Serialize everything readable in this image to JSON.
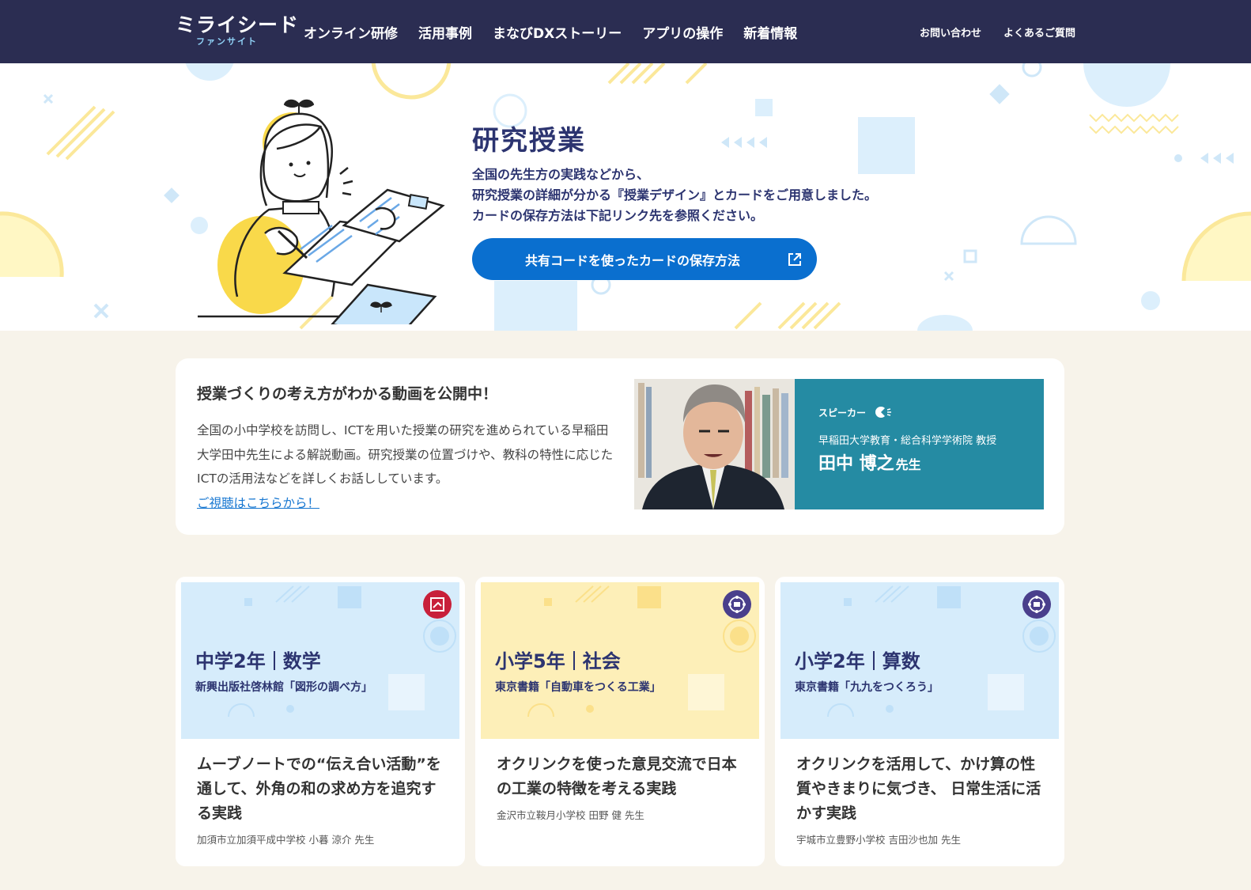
{
  "header": {
    "logo_main": "ミライシード",
    "logo_sub": "ファンサイト",
    "nav": [
      "オンライン研修",
      "活用事例",
      "まなびDXストーリー",
      "アプリの操作",
      "新着情報"
    ],
    "sub_nav": [
      "お問い合わせ",
      "よくあるご質問"
    ]
  },
  "hero": {
    "title": "研究授業",
    "description": [
      "全国の先生方の実践などから、",
      "研究授業の詳細が分かる『授業デザイン』とカードをご用意しました。",
      "カードの保存方法は下記リンク先を参照ください。"
    ],
    "button_label": "共有コードを使ったカードの保存方法"
  },
  "video": {
    "title": "授業づくりの考え方がわかる動画を公開中！",
    "body": "全国の小中学校を訪問し、ICTを用いた授業の研究を進められている早稲田大学田中先生による解説動画。研究授業の位置づけや、教科の特性に応じたICTの活用法などを詳しくお話ししています。",
    "link": "ご視聴はこちらから！",
    "speaker_label": "スピーカー",
    "speaker_affiliation": "早稲田大学教育・総合科学学術院 教授",
    "speaker_name": "田中 博之",
    "speaker_honorific": "先生"
  },
  "lessons": [
    {
      "grade": "中学2年",
      "subject": "数学",
      "textbook": "新興出版社啓林館「図形の調べ方」",
      "title": "ムーブノートでの“伝え合い活動”を通して、外角の和の求め方を追究する実践",
      "school": "加須市立加須平成中学校 小暮 涼介 先生",
      "thumb_color": "#d6ecfb",
      "badge_color": "#c8203a",
      "badge_icon": "movenote-icon"
    },
    {
      "grade": "小学5年",
      "subject": "社会",
      "textbook": "東京書籍「自動車をつくる工業」",
      "title": "オクリンクを使った意見交流で日本の工業の特徴を考える実践",
      "school": "金沢市立鞍月小学校 田野 健 先生",
      "thumb_color": "#fdefb8",
      "badge_color": "#4a3f8c",
      "badge_icon": "oklink-icon"
    },
    {
      "grade": "小学2年",
      "subject": "算数",
      "textbook": "東京書籍「九九をつくろう」",
      "title": "オクリンクを活用して、かけ算の性質やきまりに気づき、 日常生活に活かす実践",
      "school": "宇城市立豊野小学校 吉田沙也加 先生",
      "thumb_color": "#d6ecfb",
      "badge_color": "#4a3f8c",
      "badge_icon": "oklink-icon"
    }
  ]
}
